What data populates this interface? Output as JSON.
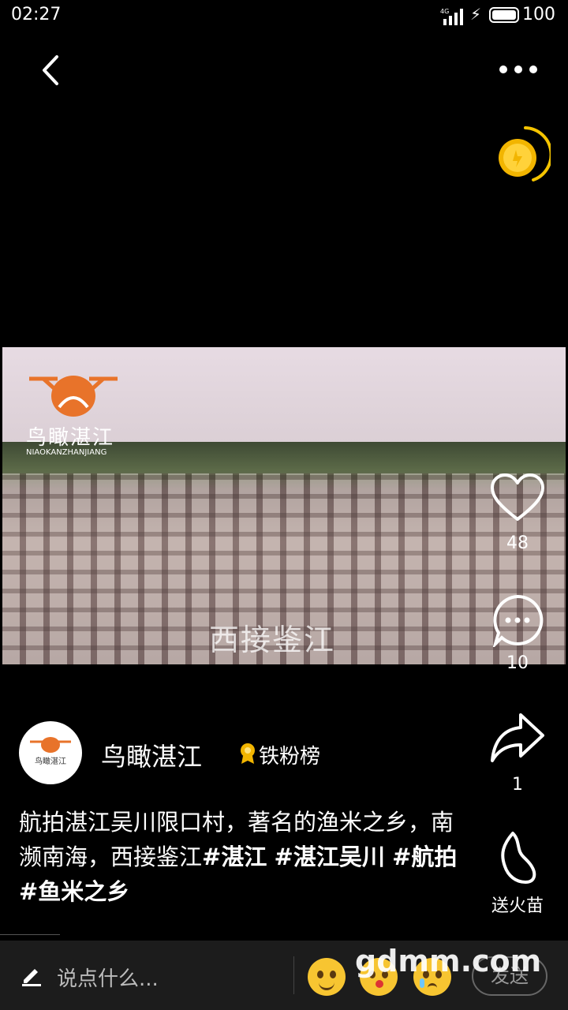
{
  "status_bar": {
    "time": "02:27",
    "network": "4G",
    "battery": "100"
  },
  "video": {
    "logo_name": "鸟瞰湛江",
    "logo_subtitle": "NIAOKANZHANJIANG",
    "caption": "西接鉴江"
  },
  "actions": {
    "likes": "48",
    "comments": "10",
    "shares": "1",
    "send_fire_label": "送火苗"
  },
  "author": {
    "name": "鸟瞰湛江",
    "avatar_text": "鸟瞰湛江",
    "badge": "铁粉榜"
  },
  "description": {
    "text": "航拍湛江吴川限口村，著名的渔米之乡，南濒南海，西接鉴江",
    "tags": [
      "#湛江",
      "#湛江吴川",
      "#航拍",
      "#鱼米之乡"
    ]
  },
  "bottom_bar": {
    "placeholder": "说点什么...",
    "send_label": "发送"
  },
  "watermark": "gdmm.com",
  "icons": [
    "back-icon",
    "more-icon",
    "coin-icon",
    "heart-icon",
    "comment-icon",
    "share-icon",
    "fire-icon",
    "pen-icon",
    "smile-emoji-icon",
    "kiss-emoji-icon",
    "cry-emoji-icon"
  ]
}
